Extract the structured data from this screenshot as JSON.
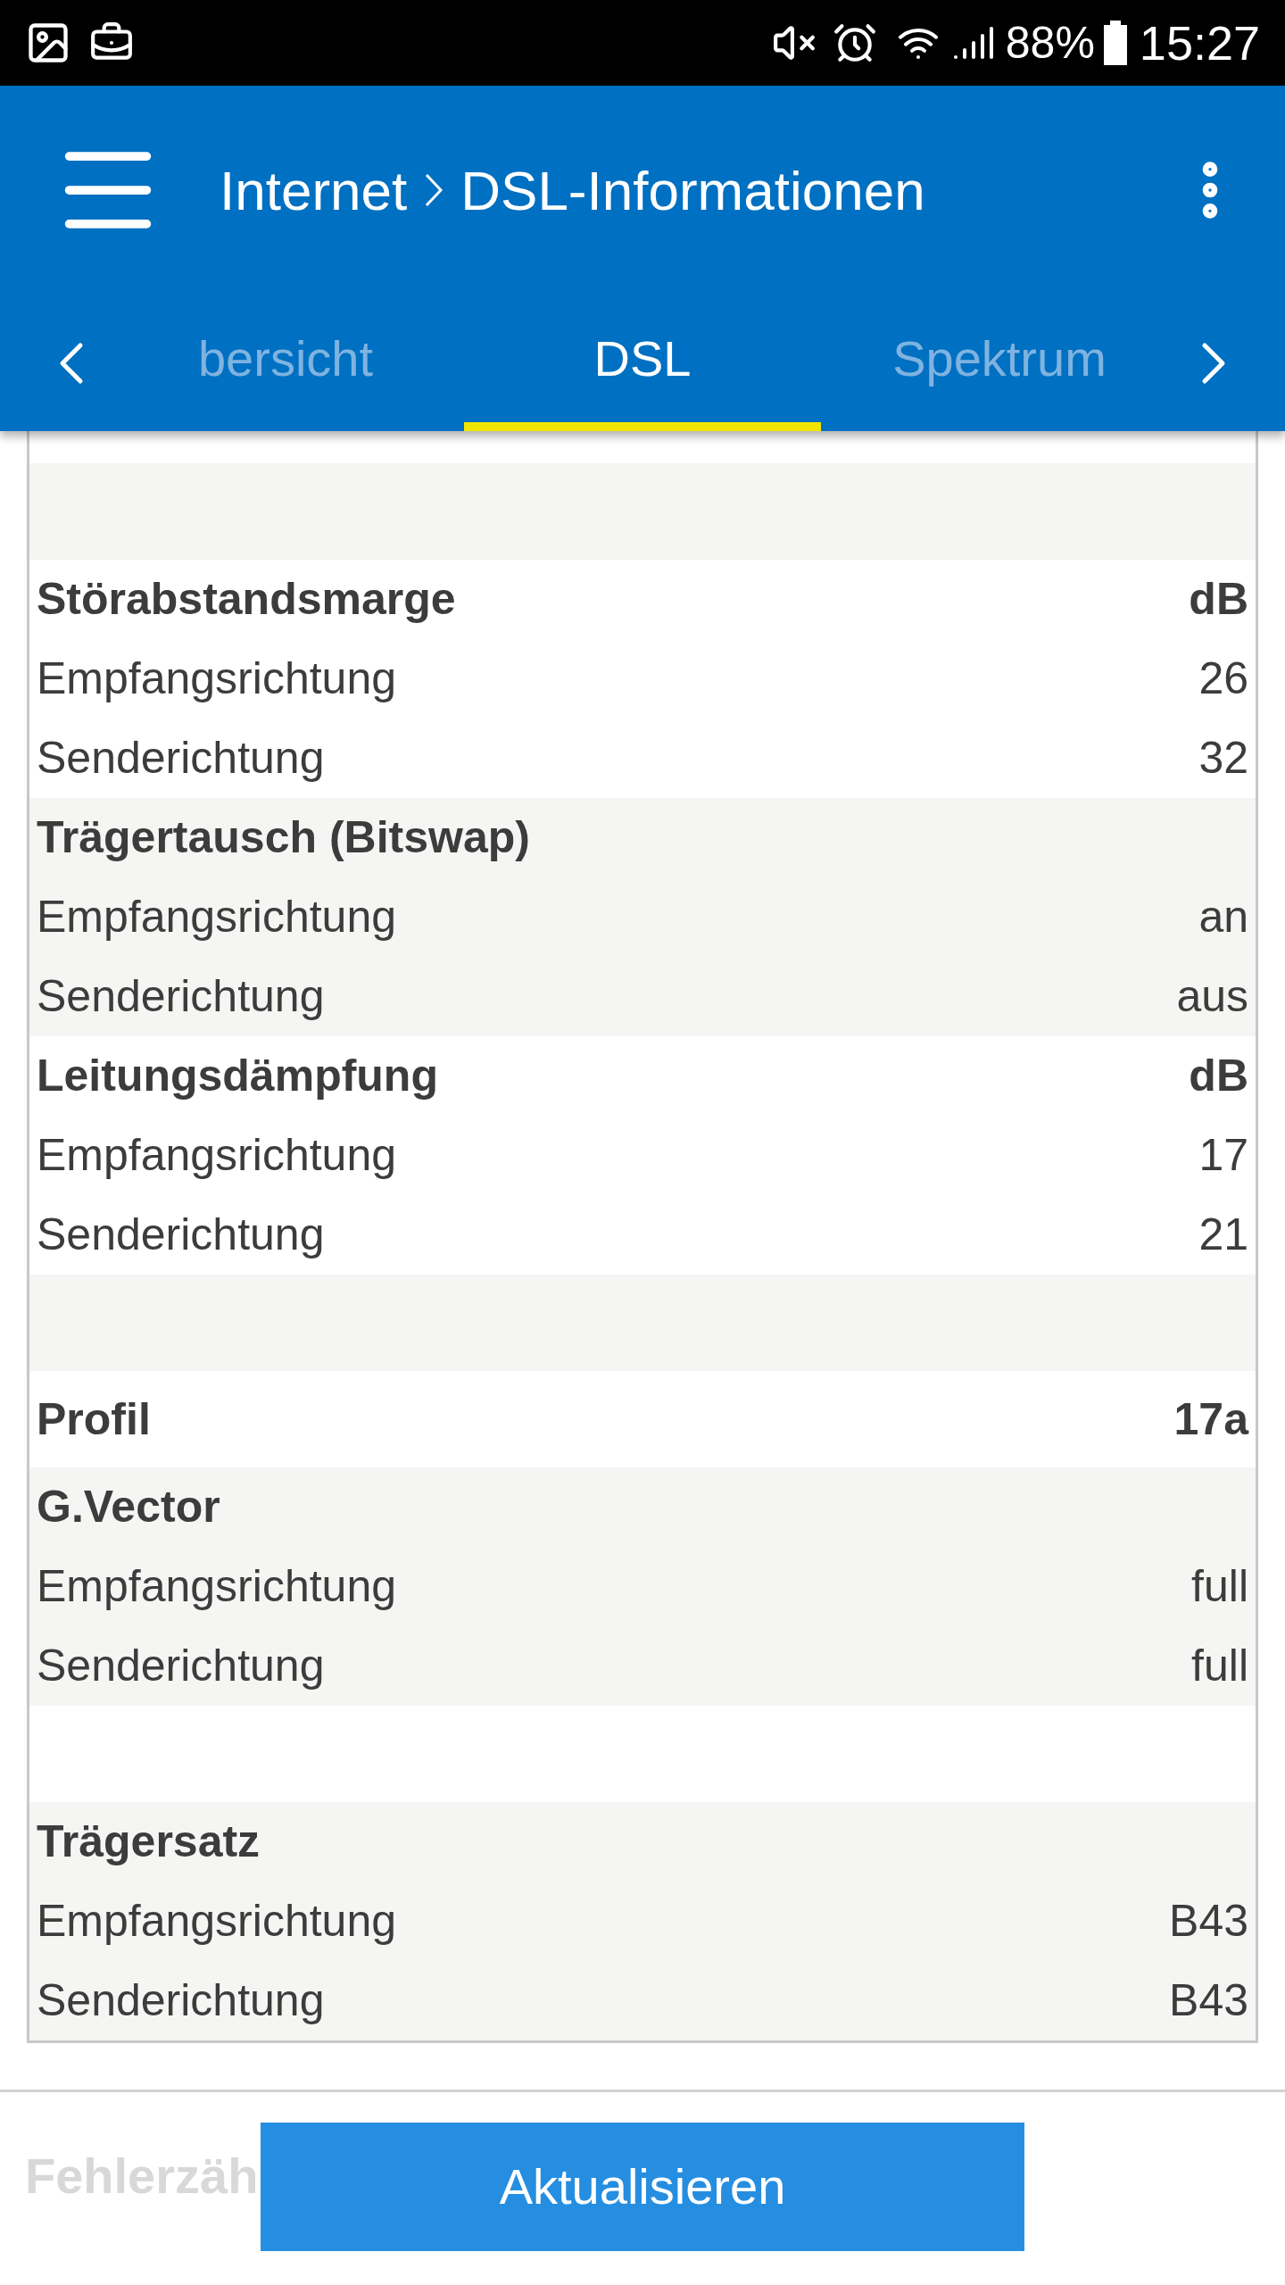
{
  "status_bar": {
    "battery": "88%",
    "time": "15:27"
  },
  "header": {
    "title": [
      "Internet",
      "DSL-Informationen"
    ]
  },
  "tabs": [
    {
      "label": "bersicht",
      "selected": false
    },
    {
      "label": "DSL",
      "selected": true
    },
    {
      "label": "Spektrum",
      "selected": false
    }
  ],
  "groups": [
    {
      "kind": "spacer"
    },
    {
      "rows": [
        {
          "kind": "heading",
          "label": "Störabstandsmarge",
          "value": "dB"
        },
        {
          "kind": "item",
          "label": "Empfangsrichtung",
          "value": "26"
        },
        {
          "kind": "item",
          "label": "Senderichtung",
          "value": "32"
        }
      ]
    },
    {
      "rows": [
        {
          "kind": "heading",
          "label": "Trägertausch (Bitswap)"
        },
        {
          "kind": "item",
          "label": "Empfangsrichtung",
          "value": "an"
        },
        {
          "kind": "item",
          "label": "Senderichtung",
          "value": "aus"
        }
      ]
    },
    {
      "rows": [
        {
          "kind": "heading",
          "label": "Leitungsdämpfung",
          "value": "dB"
        },
        {
          "kind": "item",
          "label": "Empfangsrichtung",
          "value": "17"
        },
        {
          "kind": "item",
          "label": "Senderichtung",
          "value": "21"
        }
      ]
    },
    {
      "kind": "spacer"
    },
    {
      "rows": [
        {
          "kind": "single",
          "label": "Profil",
          "value": "17a"
        }
      ]
    },
    {
      "rows": [
        {
          "kind": "heading",
          "label": "G.Vector"
        },
        {
          "kind": "item",
          "label": "Empfangsrichtung",
          "value": "full"
        },
        {
          "kind": "item",
          "label": "Senderichtung",
          "value": "full"
        }
      ]
    },
    {
      "kind": "spacer"
    },
    {
      "rows": [
        {
          "kind": "heading",
          "label": "Trägersatz"
        },
        {
          "kind": "item",
          "label": "Empfangsrichtung",
          "value": "B43"
        },
        {
          "kind": "item",
          "label": "Senderichtung",
          "value": "B43"
        }
      ]
    }
  ],
  "next_section": {
    "heading": "Fehlerzäh"
  },
  "button": {
    "label": "Aktualisieren"
  }
}
